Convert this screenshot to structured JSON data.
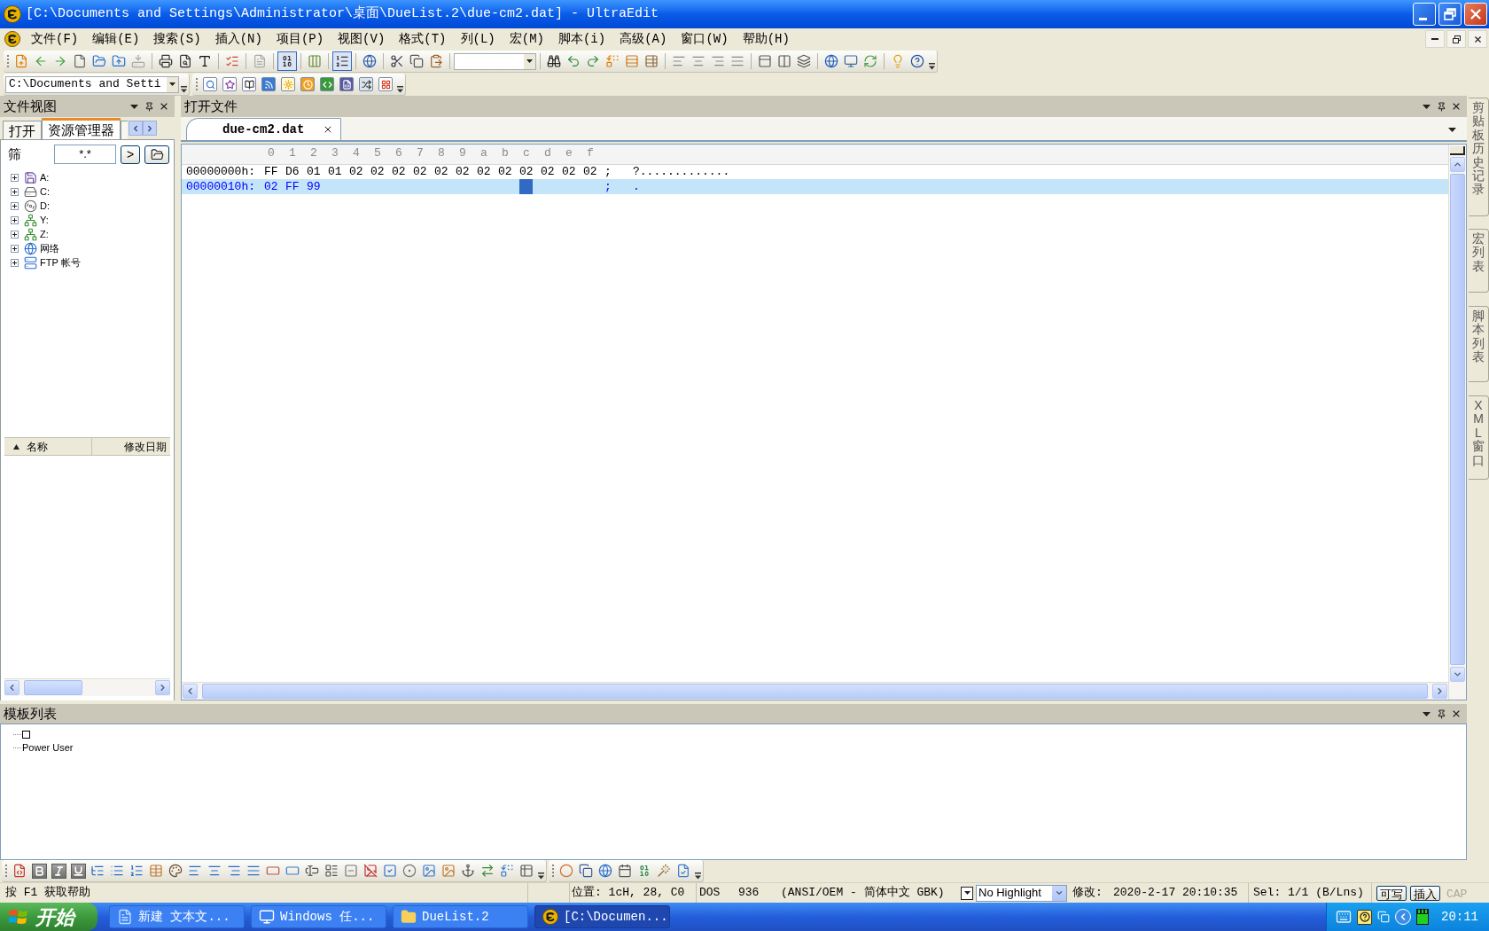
{
  "window": {
    "title": "[C:\\Documents and Settings\\Administrator\\桌面\\DueList.2\\due-cm2.dat] - UltraEdit"
  },
  "menu": [
    "文件(F)",
    "编辑(E)",
    "搜索(S)",
    "插入(N)",
    "项目(P)",
    "视图(V)",
    "格式(T)",
    "列(L)",
    "宏(M)",
    "脚本(i)",
    "高级(A)",
    "窗口(W)",
    "帮助(H)"
  ],
  "toolbar": {
    "toggles": [
      {
        "pressed": true
      },
      {
        "pressed": true
      }
    ]
  },
  "path_box": {
    "value": "C:\\Documents and Setti"
  },
  "file_view": {
    "title": "文件视图",
    "tabs": [
      {
        "label": "打开",
        "selected": false
      },
      {
        "label": "资源管理器",
        "selected": true
      }
    ],
    "filter": {
      "label": "筛",
      "value": "*.*",
      "go_button": ">"
    },
    "tree": [
      {
        "label": "A:",
        "kind": "floppy",
        "expanded": false
      },
      {
        "label": "C:",
        "kind": "drive",
        "expanded": false
      },
      {
        "label": "D:",
        "kind": "cdrom",
        "expanded": false
      },
      {
        "label": "Y:",
        "kind": "netdrive",
        "expanded": false
      },
      {
        "label": "Z:",
        "kind": "netdrive",
        "expanded": false
      },
      {
        "label": "网络",
        "kind": "network",
        "expanded": false
      },
      {
        "label": "FTP 帐号",
        "kind": "ftp",
        "expanded": false
      }
    ],
    "columns": [
      {
        "label": "名称",
        "sorted": true
      },
      {
        "label": "修改日期",
        "sorted": false
      }
    ]
  },
  "editor": {
    "title": "打开文件",
    "tabs": [
      {
        "label": "due-cm2.dat",
        "selected": true
      }
    ],
    "ruler": [
      "0",
      "1",
      "2",
      "3",
      "4",
      "5",
      "6",
      "7",
      "8",
      "9",
      "a",
      "b",
      "c",
      "d",
      "e",
      "f"
    ],
    "rows": [
      {
        "address": "00000000h:",
        "bytes": [
          "FF",
          "D6",
          "01",
          "01",
          "02",
          "02",
          "02",
          "02",
          "02",
          "02",
          "02",
          "02",
          "02",
          "02",
          "02",
          "02"
        ],
        "separator": ";",
        "ascii": "?.............",
        "current": false,
        "cursor": false
      },
      {
        "address": "00000010h:",
        "bytes": [
          "02",
          "FF",
          "99"
        ],
        "separator": ";",
        "ascii": ".",
        "current": true,
        "cursor": true
      }
    ]
  },
  "side_tabs": [
    "剪贴板历史记录",
    "宏列表",
    "脚本列表",
    "XML 窗口"
  ],
  "template_list": {
    "title": "模板列表",
    "items": [
      {
        "kind": "square"
      },
      {
        "kind": "text",
        "label": "Power User"
      }
    ]
  },
  "status_bar": {
    "help": "按 F1 获取帮助",
    "position": "位置: 1cH, 28, C0",
    "line_ending": "DOS",
    "codepage": "936",
    "encoding": "(ANSI/OEM - 简体中文 GBK)",
    "highlight": "No Highlight",
    "modified_label": "修改:",
    "modified": "2020-2-17 20:10:35",
    "selection": "Sel: 1/1 (B/Lns)",
    "toggles": [
      {
        "label": "可写",
        "disabled": false
      },
      {
        "label": "插入",
        "disabled": false
      },
      {
        "label": "CAP",
        "disabled": true
      }
    ]
  },
  "taskbar": {
    "start": "开始",
    "tasks": [
      {
        "label": "新建 文本文...",
        "kind": "notepad",
        "selected": false
      },
      {
        "label": "Windows 任...",
        "kind": "monitor",
        "selected": false
      },
      {
        "label": "DueList.2",
        "kind": "folder",
        "selected": false
      },
      {
        "label": "[C:\\Documen...",
        "kind": "app",
        "selected": true
      }
    ],
    "clock": "20:11"
  }
}
